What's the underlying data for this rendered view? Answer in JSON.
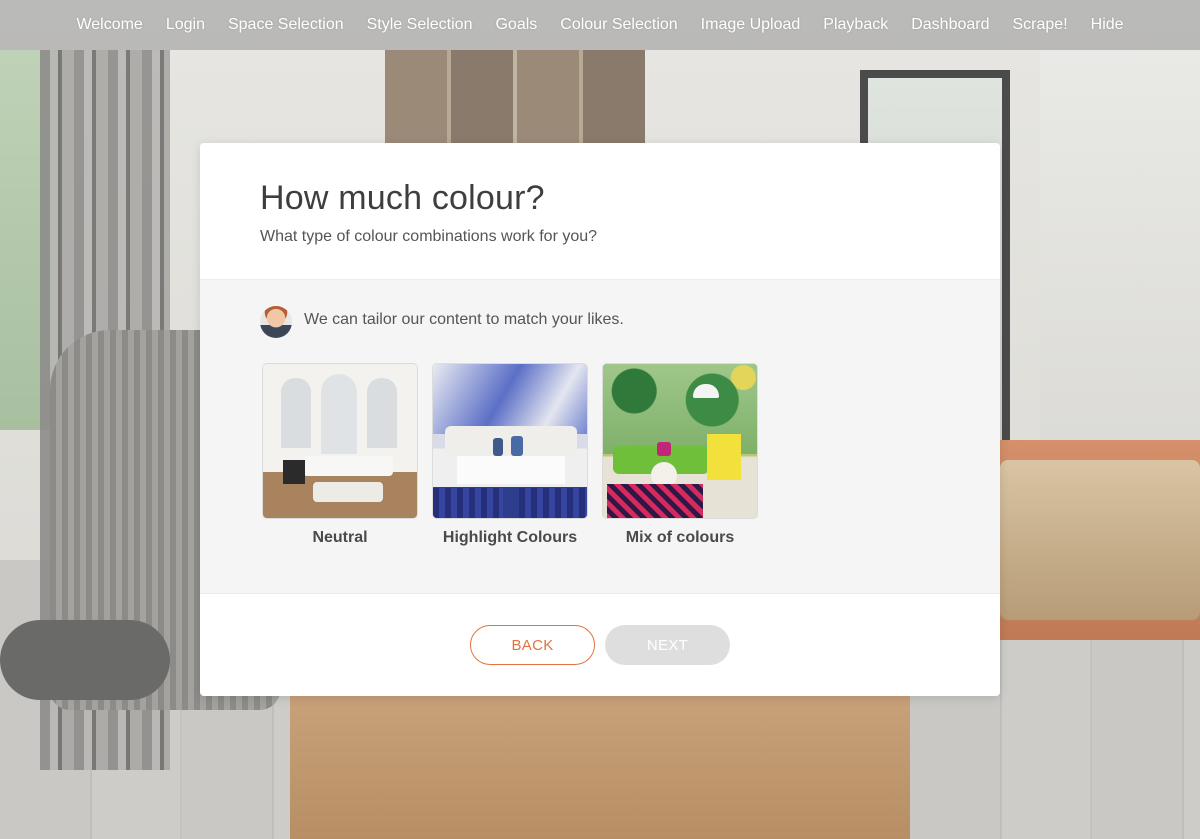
{
  "nav": {
    "items": [
      "Welcome",
      "Login",
      "Space Selection",
      "Style Selection",
      "Goals",
      "Colour Selection",
      "Image Upload",
      "Playback",
      "Dashboard",
      "Scrape!",
      "Hide"
    ]
  },
  "card": {
    "title": "How much colour?",
    "subtitle": "What type of colour combinations work for you?",
    "tailor_text": "We can tailor our content to match your likes.",
    "options": [
      {
        "label": "Neutral",
        "image": "neutral-living-room"
      },
      {
        "label": "Highlight Colours",
        "image": "blue-accent-living-room"
      },
      {
        "label": "Mix of colours",
        "image": "colourful-jungle-living-room"
      }
    ],
    "back_label": "BACK",
    "next_label": "NEXT"
  },
  "colors": {
    "accent": "#e2733f",
    "disabled_button": "#dedede",
    "nav_overlay": "rgba(150,150,150,0.55)"
  }
}
